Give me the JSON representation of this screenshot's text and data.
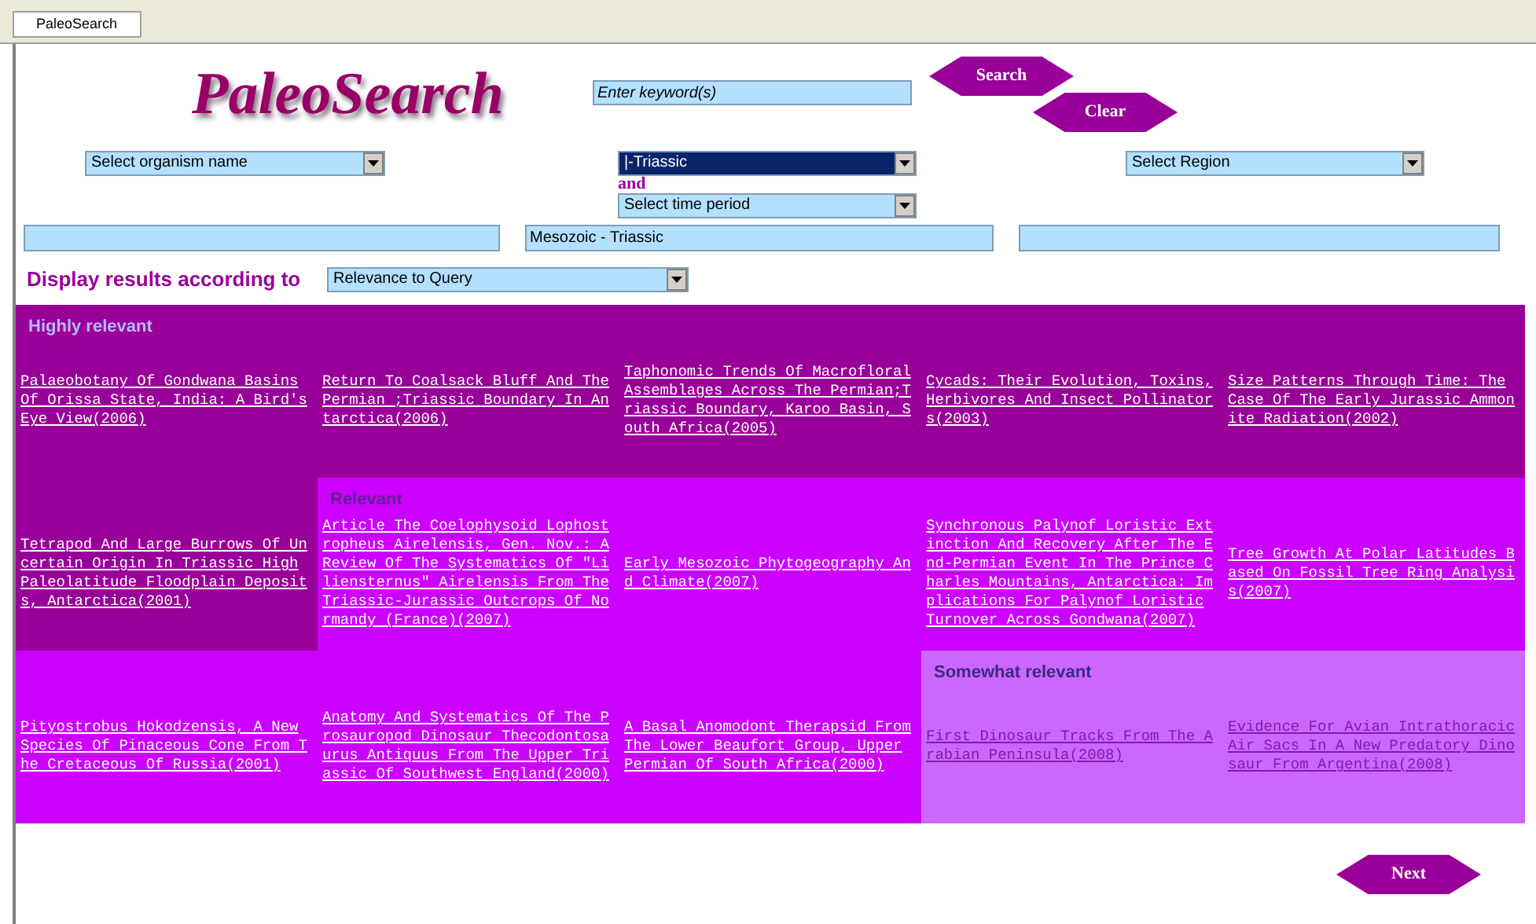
{
  "tab": {
    "label": "PaleoSearch",
    "selected": true
  },
  "logo": "PaleoSearch",
  "keyword": {
    "placeholder": "Enter keyword(s)"
  },
  "buttons": [
    {
      "label": "Search"
    },
    {
      "label": "Clear"
    }
  ],
  "organism_select": {
    "value": "Select organism name",
    "highlighted": false
  },
  "period_selects": [
    {
      "value": "|-Triassic",
      "highlighted": true
    },
    {
      "value": "Select time period",
      "highlighted": false
    }
  ],
  "and_label": "and",
  "region_select": {
    "value": "Select Region",
    "highlighted": false
  },
  "period_field": {
    "value": "Mesozoic - Triassic"
  },
  "sort": {
    "label": "Display results according to",
    "value": "Relevance to Query"
  },
  "results": [
    {
      "kind": "high",
      "heading": "Highly relevant",
      "title": "Palaeobotany Of Gondwana Basins Of Orissa State, India: A Bird's Eye View(2006)"
    },
    {
      "kind": "high",
      "title": "Return To Coalsack Bluff And The Permian ;Triassic Boundary In Antarctica(2006)"
    },
    {
      "kind": "high",
      "title": "Taphonomic Trends Of Macrofloral Assemblages Across The Permian;Triassic Boundary, Karoo Basin, South Africa(2005)"
    },
    {
      "kind": "high",
      "title": "Cycads: Their Evolution, Toxins, Herbivores And Insect Pollinators(2003)"
    },
    {
      "kind": "high",
      "title": "Size Patterns Through Time: The Case Of The Early Jurassic Ammonite Radiation(2002)"
    },
    {
      "kind": "high",
      "title": "Tetrapod And Large Burrows Of Uncertain Origin In Triassic High Paleolatitude Floodplain Deposits, Antarctica(2001)"
    },
    {
      "kind": "medium",
      "heading": "Relevant",
      "title": "Article The Coelophysoid Lophostropheus Airelensis, Gen. Nov.: A Review Of The Systematics Of \"Liliensternus\" Airelensis From The Triassic-Jurassic Outcrops Of Normandy (France)(2007)"
    },
    {
      "kind": "medium",
      "title": "Early Mesozoic Phytogeography And Climate(2007)"
    },
    {
      "kind": "medium",
      "title": "Synchronous Palynof Loristic Extinction And Recovery After The End-Permian Event In The Prince Charles Mountains, Antarctica: Implications For Palynof Loristic Turnover Across Gondwana(2007)"
    },
    {
      "kind": "medium",
      "title": "Tree Growth At Polar Latitudes Based On Fossil Tree Ring Analysis(2007)"
    },
    {
      "kind": "medium",
      "title": "Pityostrobus Hokodzensis, A New Species Of Pinaceous Cone From The Cretaceous Of Russia(2001)"
    },
    {
      "kind": "medium",
      "title": "Anatomy And Systematics Of The Prosauropod Dinosaur Thecodontosaurus Antiquus From The Upper Triassic Of Southwest England(2000)"
    },
    {
      "kind": "medium",
      "title": "A Basal Anomodont Therapsid From The Lower Beaufort Group, Upper Permian Of South Africa(2000)"
    },
    {
      "kind": "low",
      "heading": "Somewhat relevant",
      "title": "First Dinosaur Tracks From The Arabian Peninsula(2008)"
    },
    {
      "kind": "low",
      "title": "Evidence For Avian Intrathoracic Air Sacs In A New Predatory Dinosaur From Argentina(2008)"
    }
  ],
  "next_button": {
    "label": "Next"
  }
}
